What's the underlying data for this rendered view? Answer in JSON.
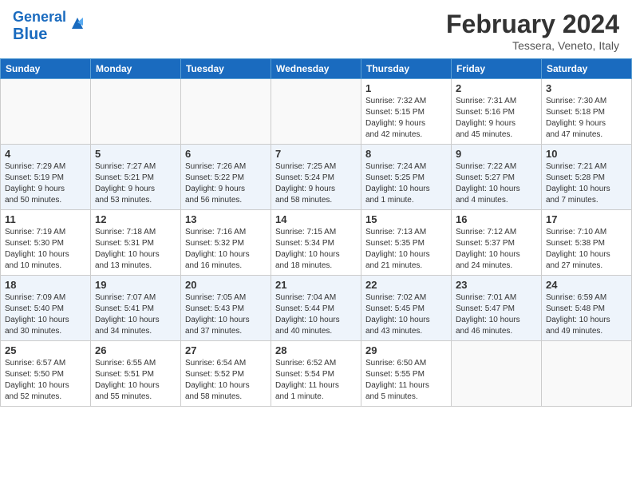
{
  "header": {
    "logo_general": "General",
    "logo_blue": "Blue",
    "title": "February 2024",
    "subtitle": "Tessera, Veneto, Italy"
  },
  "days_of_week": [
    "Sunday",
    "Monday",
    "Tuesday",
    "Wednesday",
    "Thursday",
    "Friday",
    "Saturday"
  ],
  "weeks": [
    {
      "even": false,
      "days": [
        {
          "num": "",
          "info": ""
        },
        {
          "num": "",
          "info": ""
        },
        {
          "num": "",
          "info": ""
        },
        {
          "num": "",
          "info": ""
        },
        {
          "num": "1",
          "info": "Sunrise: 7:32 AM\nSunset: 5:15 PM\nDaylight: 9 hours\nand 42 minutes."
        },
        {
          "num": "2",
          "info": "Sunrise: 7:31 AM\nSunset: 5:16 PM\nDaylight: 9 hours\nand 45 minutes."
        },
        {
          "num": "3",
          "info": "Sunrise: 7:30 AM\nSunset: 5:18 PM\nDaylight: 9 hours\nand 47 minutes."
        }
      ]
    },
    {
      "even": true,
      "days": [
        {
          "num": "4",
          "info": "Sunrise: 7:29 AM\nSunset: 5:19 PM\nDaylight: 9 hours\nand 50 minutes."
        },
        {
          "num": "5",
          "info": "Sunrise: 7:27 AM\nSunset: 5:21 PM\nDaylight: 9 hours\nand 53 minutes."
        },
        {
          "num": "6",
          "info": "Sunrise: 7:26 AM\nSunset: 5:22 PM\nDaylight: 9 hours\nand 56 minutes."
        },
        {
          "num": "7",
          "info": "Sunrise: 7:25 AM\nSunset: 5:24 PM\nDaylight: 9 hours\nand 58 minutes."
        },
        {
          "num": "8",
          "info": "Sunrise: 7:24 AM\nSunset: 5:25 PM\nDaylight: 10 hours\nand 1 minute."
        },
        {
          "num": "9",
          "info": "Sunrise: 7:22 AM\nSunset: 5:27 PM\nDaylight: 10 hours\nand 4 minutes."
        },
        {
          "num": "10",
          "info": "Sunrise: 7:21 AM\nSunset: 5:28 PM\nDaylight: 10 hours\nand 7 minutes."
        }
      ]
    },
    {
      "even": false,
      "days": [
        {
          "num": "11",
          "info": "Sunrise: 7:19 AM\nSunset: 5:30 PM\nDaylight: 10 hours\nand 10 minutes."
        },
        {
          "num": "12",
          "info": "Sunrise: 7:18 AM\nSunset: 5:31 PM\nDaylight: 10 hours\nand 13 minutes."
        },
        {
          "num": "13",
          "info": "Sunrise: 7:16 AM\nSunset: 5:32 PM\nDaylight: 10 hours\nand 16 minutes."
        },
        {
          "num": "14",
          "info": "Sunrise: 7:15 AM\nSunset: 5:34 PM\nDaylight: 10 hours\nand 18 minutes."
        },
        {
          "num": "15",
          "info": "Sunrise: 7:13 AM\nSunset: 5:35 PM\nDaylight: 10 hours\nand 21 minutes."
        },
        {
          "num": "16",
          "info": "Sunrise: 7:12 AM\nSunset: 5:37 PM\nDaylight: 10 hours\nand 24 minutes."
        },
        {
          "num": "17",
          "info": "Sunrise: 7:10 AM\nSunset: 5:38 PM\nDaylight: 10 hours\nand 27 minutes."
        }
      ]
    },
    {
      "even": true,
      "days": [
        {
          "num": "18",
          "info": "Sunrise: 7:09 AM\nSunset: 5:40 PM\nDaylight: 10 hours\nand 30 minutes."
        },
        {
          "num": "19",
          "info": "Sunrise: 7:07 AM\nSunset: 5:41 PM\nDaylight: 10 hours\nand 34 minutes."
        },
        {
          "num": "20",
          "info": "Sunrise: 7:05 AM\nSunset: 5:43 PM\nDaylight: 10 hours\nand 37 minutes."
        },
        {
          "num": "21",
          "info": "Sunrise: 7:04 AM\nSunset: 5:44 PM\nDaylight: 10 hours\nand 40 minutes."
        },
        {
          "num": "22",
          "info": "Sunrise: 7:02 AM\nSunset: 5:45 PM\nDaylight: 10 hours\nand 43 minutes."
        },
        {
          "num": "23",
          "info": "Sunrise: 7:01 AM\nSunset: 5:47 PM\nDaylight: 10 hours\nand 46 minutes."
        },
        {
          "num": "24",
          "info": "Sunrise: 6:59 AM\nSunset: 5:48 PM\nDaylight: 10 hours\nand 49 minutes."
        }
      ]
    },
    {
      "even": false,
      "days": [
        {
          "num": "25",
          "info": "Sunrise: 6:57 AM\nSunset: 5:50 PM\nDaylight: 10 hours\nand 52 minutes."
        },
        {
          "num": "26",
          "info": "Sunrise: 6:55 AM\nSunset: 5:51 PM\nDaylight: 10 hours\nand 55 minutes."
        },
        {
          "num": "27",
          "info": "Sunrise: 6:54 AM\nSunset: 5:52 PM\nDaylight: 10 hours\nand 58 minutes."
        },
        {
          "num": "28",
          "info": "Sunrise: 6:52 AM\nSunset: 5:54 PM\nDaylight: 11 hours\nand 1 minute."
        },
        {
          "num": "29",
          "info": "Sunrise: 6:50 AM\nSunset: 5:55 PM\nDaylight: 11 hours\nand 5 minutes."
        },
        {
          "num": "",
          "info": ""
        },
        {
          "num": "",
          "info": ""
        }
      ]
    }
  ]
}
